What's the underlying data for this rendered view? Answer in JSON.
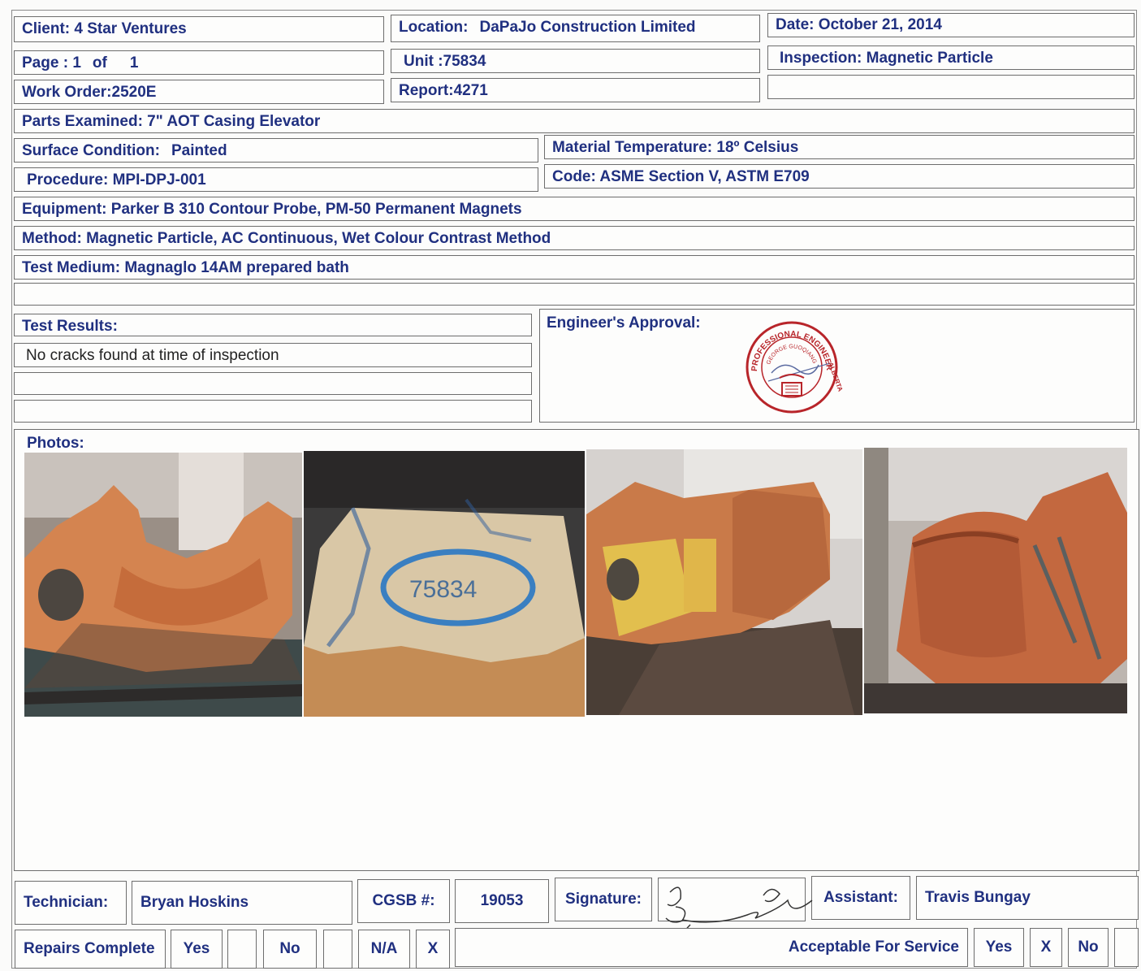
{
  "header": {
    "client_label": "Client:",
    "client_value": "4 Star Ventures",
    "location_label": "Location:",
    "location_value": "DaPaJo Construction Limited",
    "date_label": "Date:",
    "date_value": "October 21, 2014",
    "page_label": "Page :",
    "page_num": "1",
    "page_of": "of",
    "page_total": "1",
    "unit_label": "Unit :",
    "unit_value": "75834",
    "inspection_label": "Inspection:",
    "inspection_value": "Magnetic Particle",
    "work_order_label": "Work Order:",
    "work_order_value": "2520E",
    "report_label": "Report:",
    "report_value": "4271"
  },
  "details": {
    "parts_examined": "Parts Examined: 7\" AOT Casing Elevator",
    "surface_label": "Surface Condition:",
    "surface_value": "Painted",
    "material_temp": "Material Temperature: 18º Celsius",
    "procedure": "Procedure: MPI-DPJ-001",
    "code": "Code: ASME Section V, ASTM E709",
    "equipment": "Equipment: Parker B 310 Contour Probe, PM-50 Permanent Magnets",
    "method": "Method: Magnetic Particle, AC Continuous, Wet Colour Contrast Method",
    "test_medium": "Test Medium: Magnaglo 14AM prepared bath"
  },
  "results": {
    "label": "Test Results:",
    "line1": "No cracks found at time of inspection",
    "engineer_label": "Engineer's Approval:",
    "stamp_text_top": "PROFESSIONAL ENGINEER",
    "stamp_text_inner": "GEORGE GUOQIANG HE",
    "stamp_text_right": "ALBERTA"
  },
  "photos": {
    "label": "Photos:",
    "photo2_marking": "75834"
  },
  "footer": {
    "technician_label": "Technician:",
    "technician_value": "Bryan Hoskins",
    "cgsb_label": "CGSB #:",
    "cgsb_value": "19053",
    "signature_label": "Signature:",
    "assistant_label": "Assistant:",
    "assistant_value": "Travis Bungay",
    "repairs_label": "Repairs Complete",
    "yes": "Yes",
    "no": "No",
    "na": "N/A",
    "na_mark": "X",
    "acceptable_label": "Acceptable For Service",
    "acc_yes": "Yes",
    "acc_mark": "X",
    "acc_no": "No"
  },
  "colors": {
    "text_blue": "#203080",
    "stamp_red": "#b8252a",
    "marker_blue": "#3a7fc1"
  }
}
